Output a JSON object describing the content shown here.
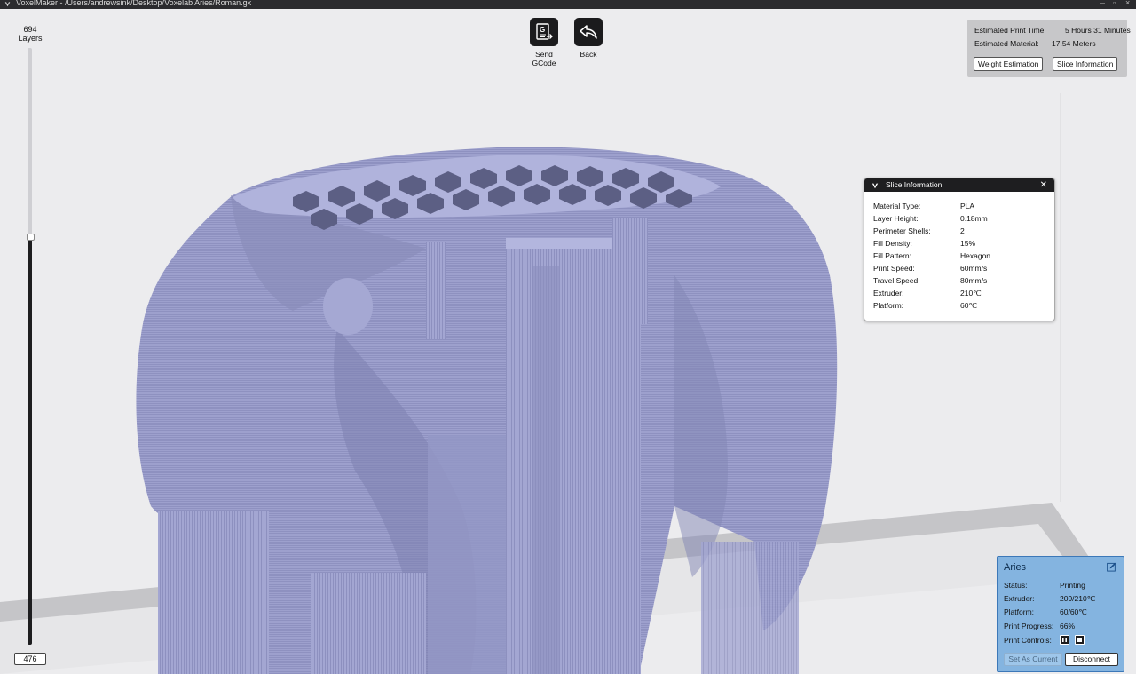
{
  "window": {
    "title": "VoxelMaker - /Users/andrewsink/Desktop/Voxelab Aries/Roman.gx"
  },
  "layers": {
    "total": "694",
    "label": "Layers",
    "current": "476"
  },
  "toolbar": {
    "send_gcode_line1": "Send",
    "send_gcode_line2": "GCode",
    "back_label": "Back"
  },
  "print_info": {
    "time_label": "Estimated Print Time:",
    "time_value": "5 Hours 31 Minutes",
    "material_label": "Estimated Material:",
    "material_value": "17.54 Meters",
    "weight_button": "Weight Estimation",
    "slice_button": "Slice Information"
  },
  "slice_dialog": {
    "title": "Slice Information",
    "rows": [
      {
        "label": "Material Type:",
        "value": "PLA"
      },
      {
        "label": "Layer Height:",
        "value": "0.18mm"
      },
      {
        "label": "Perimeter Shells:",
        "value": "2"
      },
      {
        "label": "Fill Density:",
        "value": "15%"
      },
      {
        "label": "Fill Pattern:",
        "value": "Hexagon"
      },
      {
        "label": "Print Speed:",
        "value": "60mm/s"
      },
      {
        "label": "Travel Speed:",
        "value": "80mm/s"
      },
      {
        "label": "Extruder:",
        "value": "210℃"
      },
      {
        "label": "Platform:",
        "value": "60℃"
      }
    ]
  },
  "printer": {
    "name": "Aries",
    "status_label": "Status:",
    "status_value": "Printing",
    "extruder_label": "Extruder:",
    "extruder_value": "209/210℃",
    "platform_label": "Platform:",
    "platform_value": "60/60℃",
    "progress_label": "Print Progress:",
    "progress_value": "66%",
    "controls_label": "Print Controls:",
    "set_current_button": "Set As Current",
    "disconnect_button": "Disconnect"
  },
  "icons": {
    "app_logo": "voxelmaker-logo-icon",
    "send_gcode": "gcode-file-icon",
    "back": "back-arrow-icon",
    "edit": "edit-icon",
    "pause": "pause-icon",
    "stop": "stop-icon",
    "close": "close-icon"
  },
  "colors": {
    "model": "#9c9fcc",
    "printer_panel": "#84b4e0",
    "dialog_header": "#1e1e20"
  }
}
